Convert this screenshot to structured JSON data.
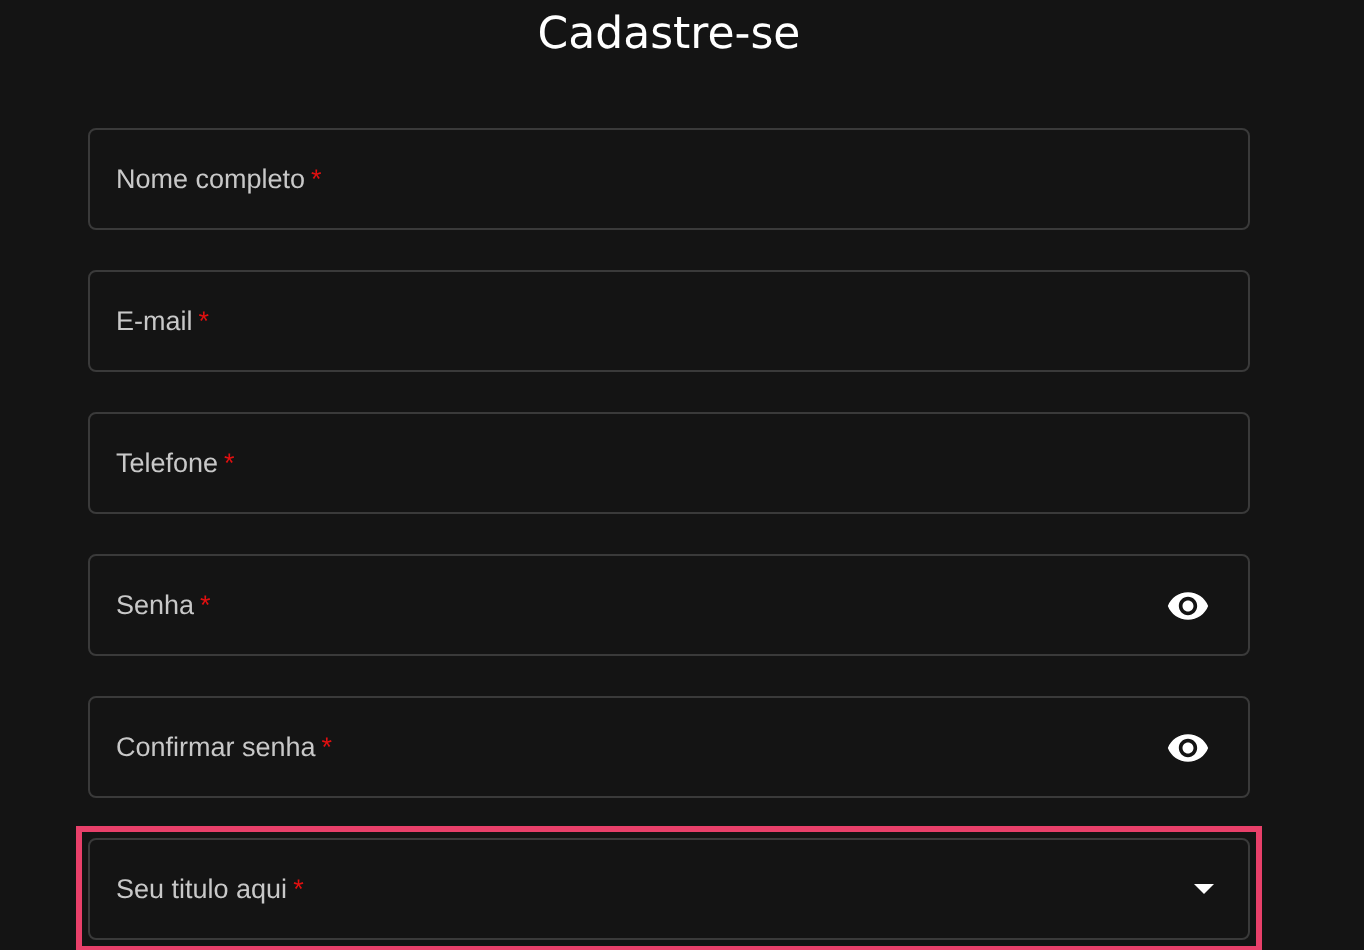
{
  "title": "Cadastre-se",
  "fields": [
    {
      "kind": "text",
      "label": "Nome completo",
      "required_mark": "*",
      "highlighted": false
    },
    {
      "kind": "text",
      "label": "E-mail",
      "required_mark": "*",
      "highlighted": false
    },
    {
      "kind": "text",
      "label": "Telefone",
      "required_mark": "*",
      "highlighted": false
    },
    {
      "kind": "password",
      "label": "Senha",
      "required_mark": "*",
      "highlighted": false
    },
    {
      "kind": "password",
      "label": "Confirmar senha",
      "required_mark": "*",
      "highlighted": false
    },
    {
      "kind": "select",
      "label": "Seu titulo aqui",
      "required_mark": "*",
      "highlighted": true
    }
  ]
}
